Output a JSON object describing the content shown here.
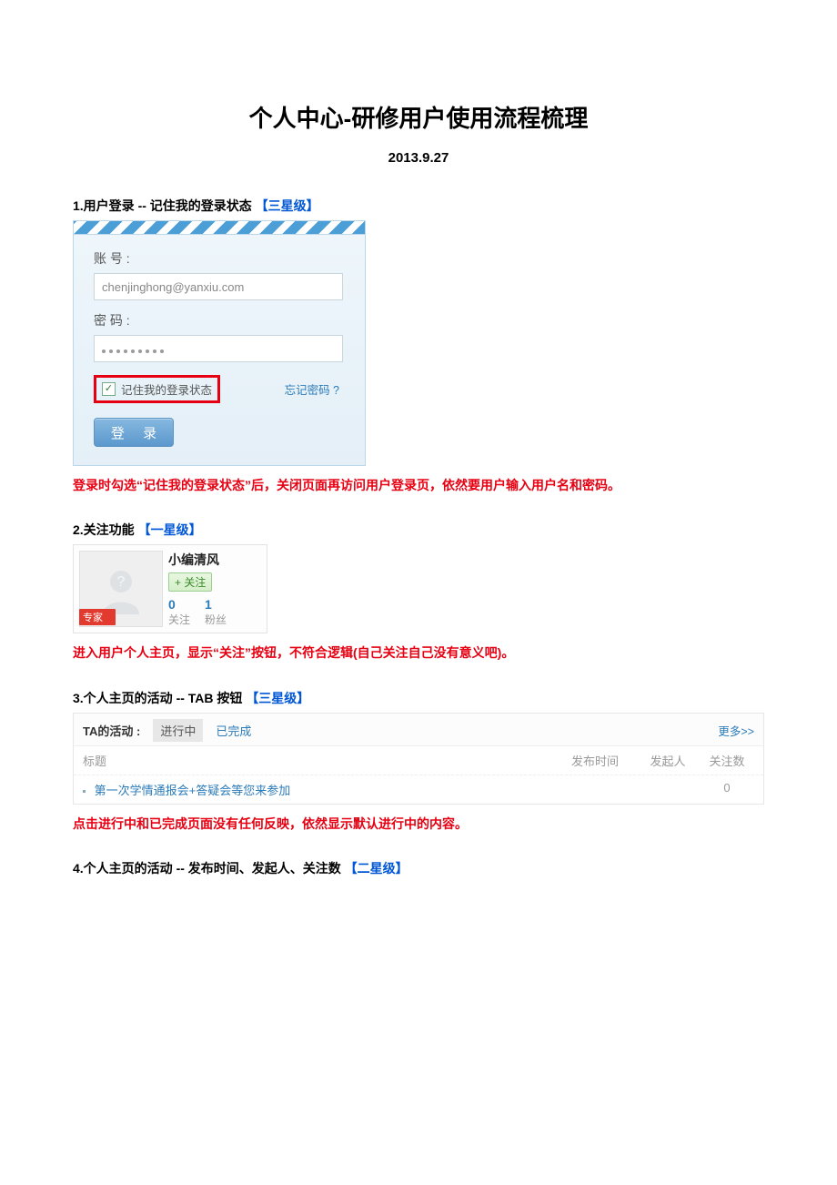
{
  "doc": {
    "title": "个人中心-研修用户使用流程梳理",
    "date": "2013.9.27"
  },
  "s1": {
    "prefix": "1.用户登录   --   记住我的登录状态",
    "level": "【三星级】",
    "login": {
      "account_label": "账 号 :",
      "account_value": "chenjinghong@yanxiu.com",
      "password_label": "密 码 :",
      "remember_text": "记住我的登录状态",
      "forgot": "忘记密码 ?",
      "login_btn": "登 录"
    },
    "note": "登录时勾选“记住我的登录状态”后，关闭页面再访问用户登录页，依然要用户输入用户名和密码。"
  },
  "s2": {
    "prefix": "2.关注功能",
    "level": "【一星级】",
    "profile": {
      "name": "小编清风",
      "follow_btn": "+ 关注",
      "expert": "专家",
      "stats": {
        "follow_n": "0",
        "follow_l": "关注",
        "fans_n": "1",
        "fans_l": "粉丝"
      }
    },
    "note": "进入用户个人主页，显示“关注”按钮，不符合逻辑(自己关注自己没有意义吧)。"
  },
  "s3": {
    "prefix": "3.个人主页的活动   --   TAB 按钮",
    "level": "【三星级】",
    "act": {
      "title": "TA的活动 :",
      "tab_on": "进行中",
      "tab_off": "已完成",
      "more": "更多>>",
      "headers": {
        "title": "标题",
        "time": "发布时间",
        "owner": "发起人",
        "follow": "关注数"
      },
      "row": {
        "title": "第一次学情通报会+答疑会等您来参加",
        "follow": "0"
      }
    },
    "note": "点击进行中和已完成页面没有任何反映，依然显示默认进行中的内容。"
  },
  "s4": {
    "prefix": "4.个人主页的活动  --  发布时间、发起人、关注数",
    "level": "【二星级】"
  }
}
